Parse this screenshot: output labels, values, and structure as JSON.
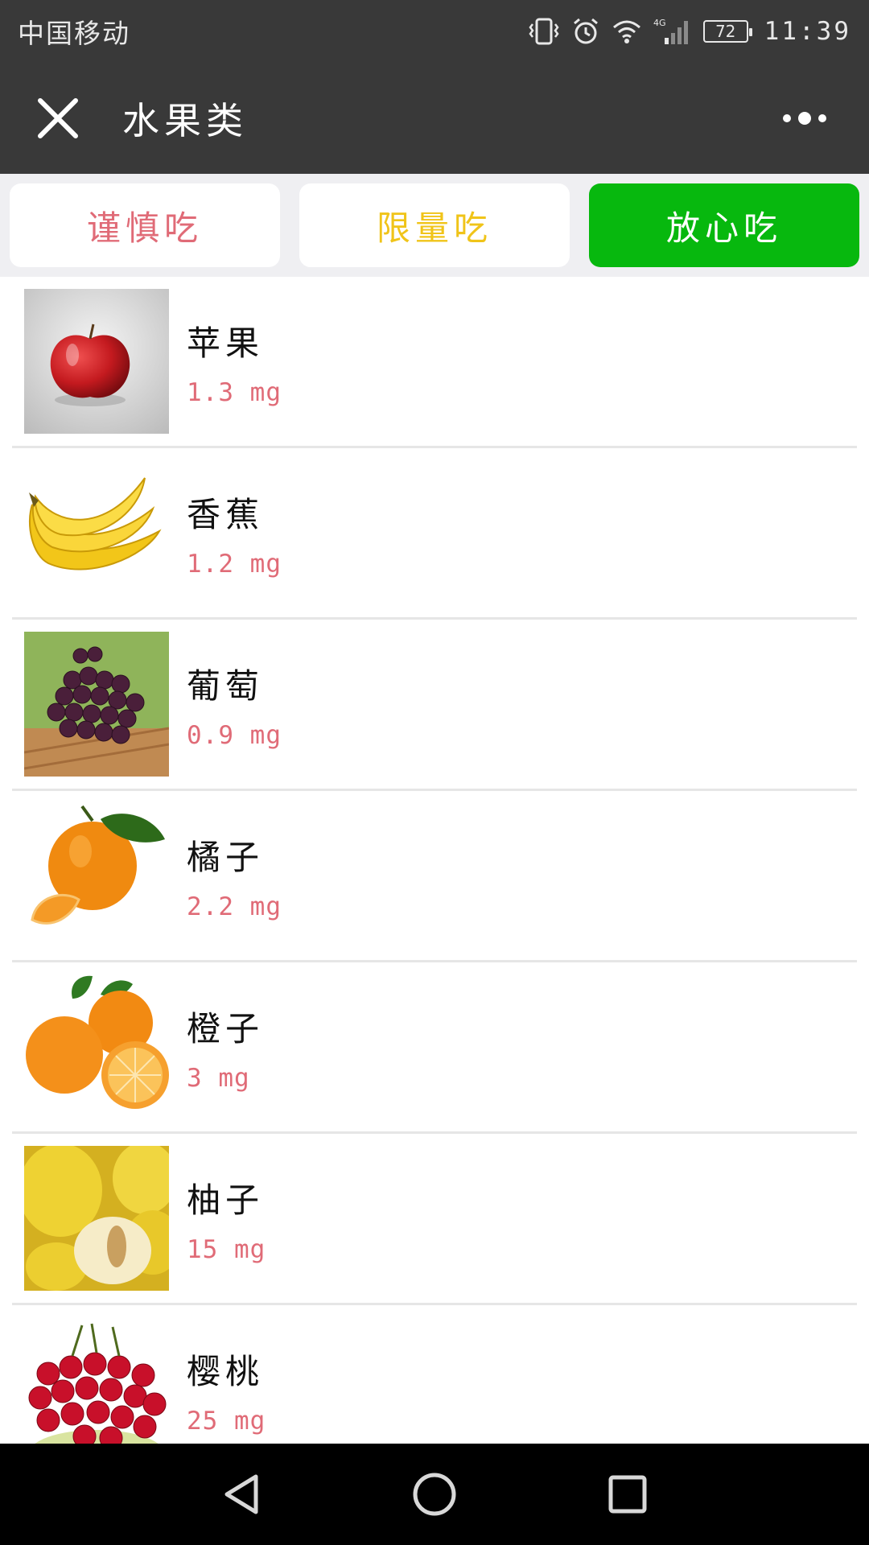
{
  "status_bar": {
    "carrier": "中国移动",
    "network": "4G",
    "battery": "72",
    "time": "11:39"
  },
  "header": {
    "title": "水果类",
    "close_icon": "close-icon",
    "more_icon": "more-icon"
  },
  "tabs": [
    {
      "label": "谨慎吃",
      "color": "#e06b77",
      "active": false
    },
    {
      "label": "限量吃",
      "color": "#f0c419",
      "active": false
    },
    {
      "label": "放心吃",
      "color": "#07b80e",
      "active": true
    }
  ],
  "items": [
    {
      "name": "苹果",
      "value": "1.3 mg",
      "image": "apple"
    },
    {
      "name": "香蕉",
      "value": "1.2 mg",
      "image": "banana"
    },
    {
      "name": "葡萄",
      "value": "0.9 mg",
      "image": "grapes"
    },
    {
      "name": "橘子",
      "value": "2.2 mg",
      "image": "tangerine"
    },
    {
      "name": "橙子",
      "value": "3 mg",
      "image": "orange"
    },
    {
      "name": "柚子",
      "value": "15 mg",
      "image": "pomelo"
    },
    {
      "name": "樱桃",
      "value": "25 mg",
      "image": "cherry"
    }
  ],
  "nav": {
    "back_icon": "back-triangle-icon",
    "home_icon": "home-circle-icon",
    "recents_icon": "recents-square-icon"
  },
  "colors": {
    "header_bg": "#393939",
    "value_text": "#e06b77",
    "active_tab": "#07b80e"
  }
}
